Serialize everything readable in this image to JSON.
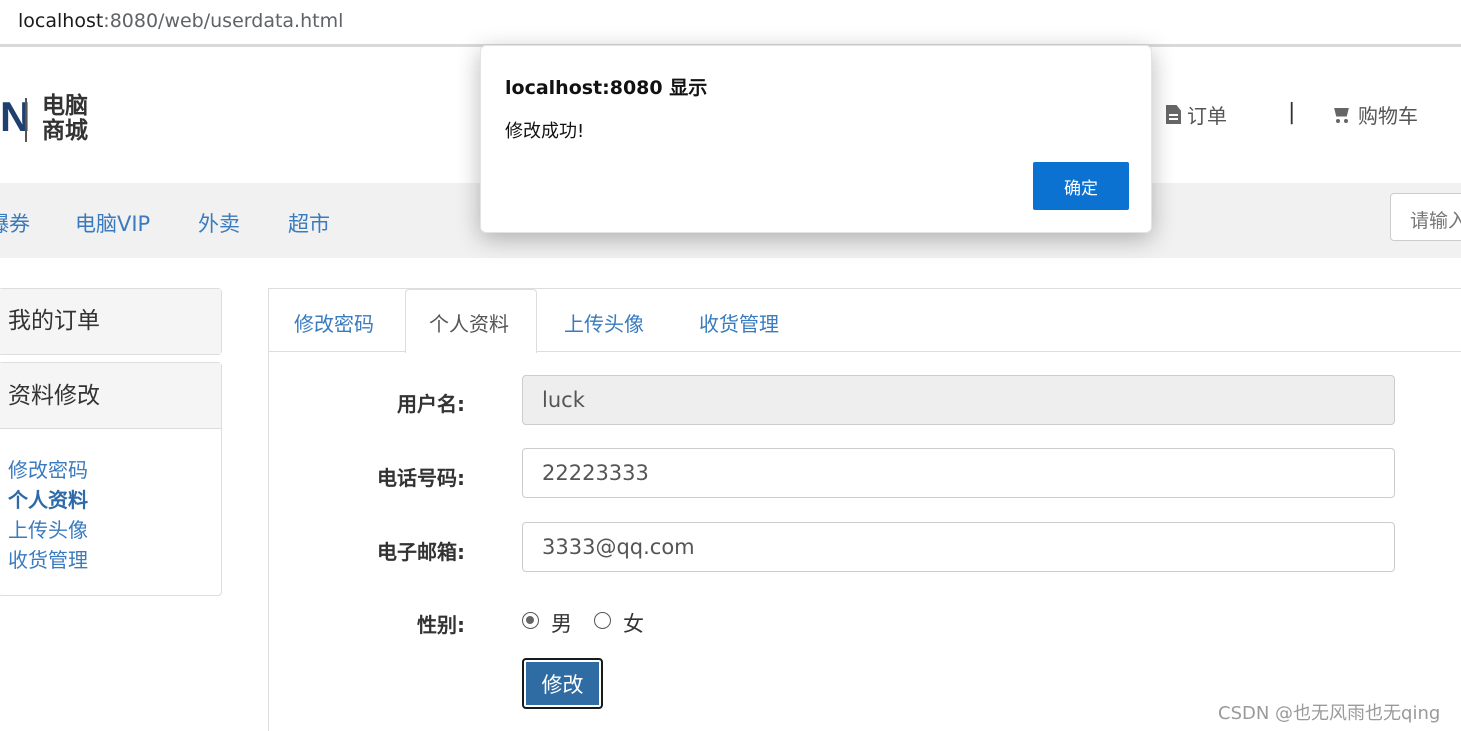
{
  "browser": {
    "url_host": "localhost",
    "url_rest": ":8080/web/userdata.html"
  },
  "logo": {
    "mark": "N",
    "line1": "电脑",
    "line2": "商城"
  },
  "header_links": {
    "orders": "订单",
    "separator": "|",
    "cart": "购物车"
  },
  "nav": {
    "items": [
      "爆券",
      "电脑VIP",
      "外卖",
      "超市"
    ],
    "search_placeholder": "请输入"
  },
  "sidebar": {
    "my_orders": "我的订单",
    "profile_edit": "资料修改",
    "links": [
      "修改密码",
      "个人资料",
      "上传头像",
      "收货管理"
    ],
    "active_index": 1
  },
  "tabs": {
    "items": [
      "修改密码",
      "个人资料",
      "上传头像",
      "收货管理"
    ],
    "active_index": 1
  },
  "form": {
    "username_label": "用户名:",
    "username_value": "luck",
    "phone_label": "电话号码:",
    "phone_value": "22223333",
    "email_label": "电子邮箱:",
    "email_value": "3333@qq.com",
    "gender_label": "性别:",
    "gender_options": [
      "男",
      "女"
    ],
    "gender_selected": "男",
    "submit_label": "修改"
  },
  "dialog": {
    "title": "localhost:8080 显示",
    "message": "修改成功!",
    "ok_label": "确定"
  },
  "watermark": "CSDN @也无风雨也无qing",
  "colors": {
    "link": "#3a7bbf",
    "primary_button": "#2f6ca4",
    "dialog_button": "#0b72d2"
  }
}
